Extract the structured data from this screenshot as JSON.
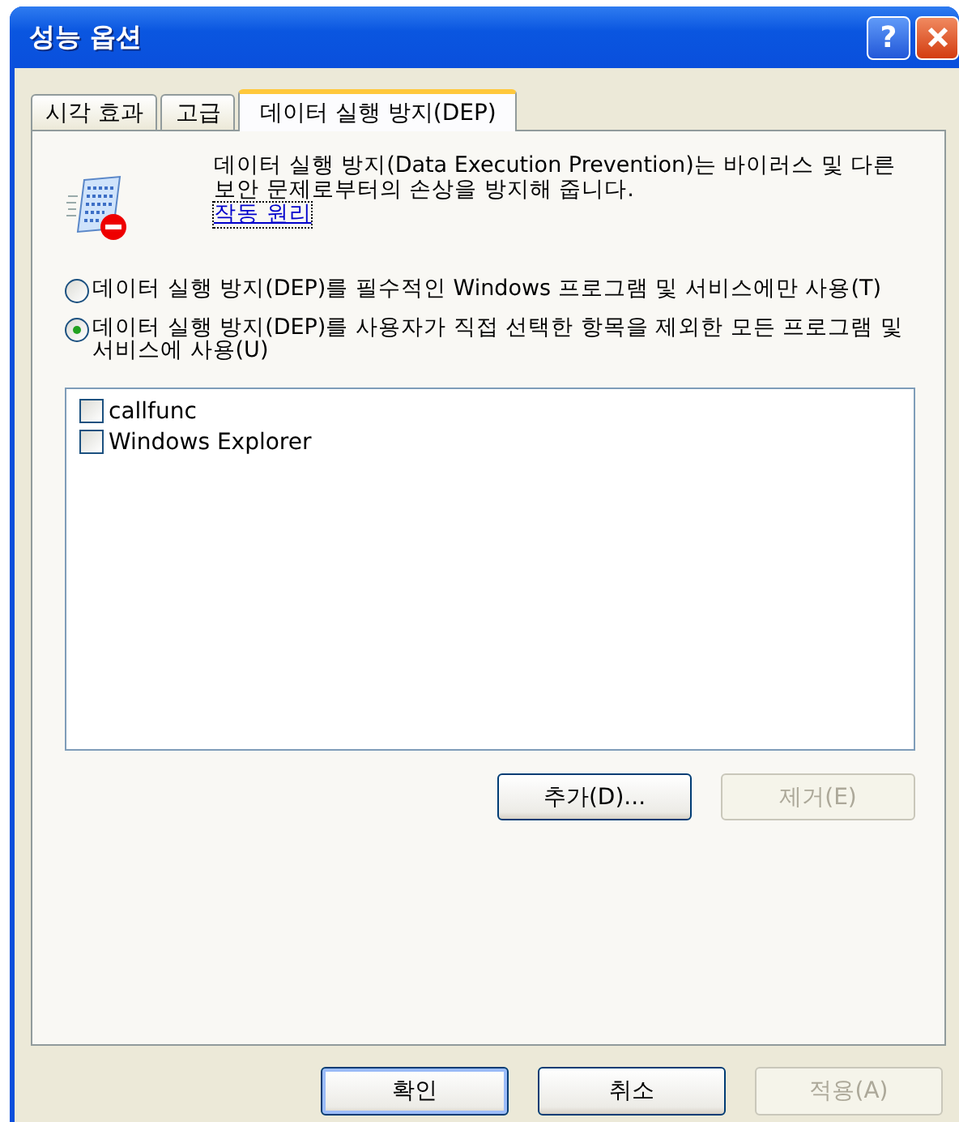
{
  "window": {
    "title": "성능 옵션"
  },
  "title_buttons": [
    {
      "kind": "help",
      "label": "?"
    },
    {
      "kind": "close"
    }
  ],
  "tabs": [
    {
      "label": "시각 효과",
      "selected": false
    },
    {
      "label": "고급",
      "selected": false
    },
    {
      "label": "데이터 실행 방지(DEP)",
      "selected": true
    }
  ],
  "description": "데이터 실행 방지(Data Execution Prevention)는 바이러스 및 다른 보안 문제로부터의 손상을 방지해 줍니다.",
  "link": "작동 원리",
  "options": [
    {
      "label": "데이터 실행 방지(DEP)를 필수적인 Windows 프로그램 및 서비스에만 사용(T)",
      "selected": false
    },
    {
      "label": "데이터 실행 방지(DEP)를 사용자가 직접 선택한 항목을 제외한 모든 프로그램 및 서비스에 사용(U)",
      "selected": true
    }
  ],
  "exceptions": [
    {
      "label": "callfunc",
      "checked": false
    },
    {
      "label": "Windows Explorer",
      "checked": false
    }
  ],
  "list_buttons": [
    {
      "label": "추가(D)...",
      "disabled": false
    },
    {
      "label": "제거(E)",
      "disabled": true
    }
  ],
  "buttons": [
    {
      "label": "확인",
      "disabled": false,
      "default": true
    },
    {
      "label": "취소",
      "disabled": false,
      "default": false
    },
    {
      "label": "적용(A)",
      "disabled": true,
      "default": false
    }
  ]
}
